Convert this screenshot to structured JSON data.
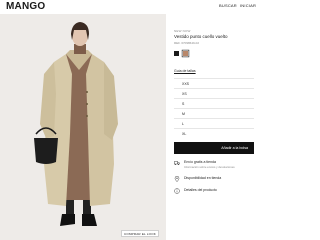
{
  "header": {
    "logo": "MANGO",
    "search_label": "BUSCAR",
    "login_label": "INICIAR"
  },
  "gallery": {
    "look_button": "COMPRAR EL LOOK"
  },
  "product": {
    "badge": "NEW NOW",
    "title": "Vestido punto cuello vuelto",
    "reference": "REF. 67098649-02",
    "colors": [
      {
        "name": "black",
        "hex": "#1a1a1a"
      },
      {
        "name": "camel",
        "hex": "#b8876a"
      }
    ],
    "size_guide": "Guía de tallas",
    "sizes": [
      "XXS",
      "XS",
      "S",
      "M",
      "L",
      "XL"
    ],
    "add_button": "Añadir a la bolsa",
    "shipping_title": "Envío gratis a tienda",
    "shipping_subtitle": "Información sobre envíos y devoluciones",
    "availability": "Disponibilidad en tienda",
    "details": "Detalles del producto"
  }
}
